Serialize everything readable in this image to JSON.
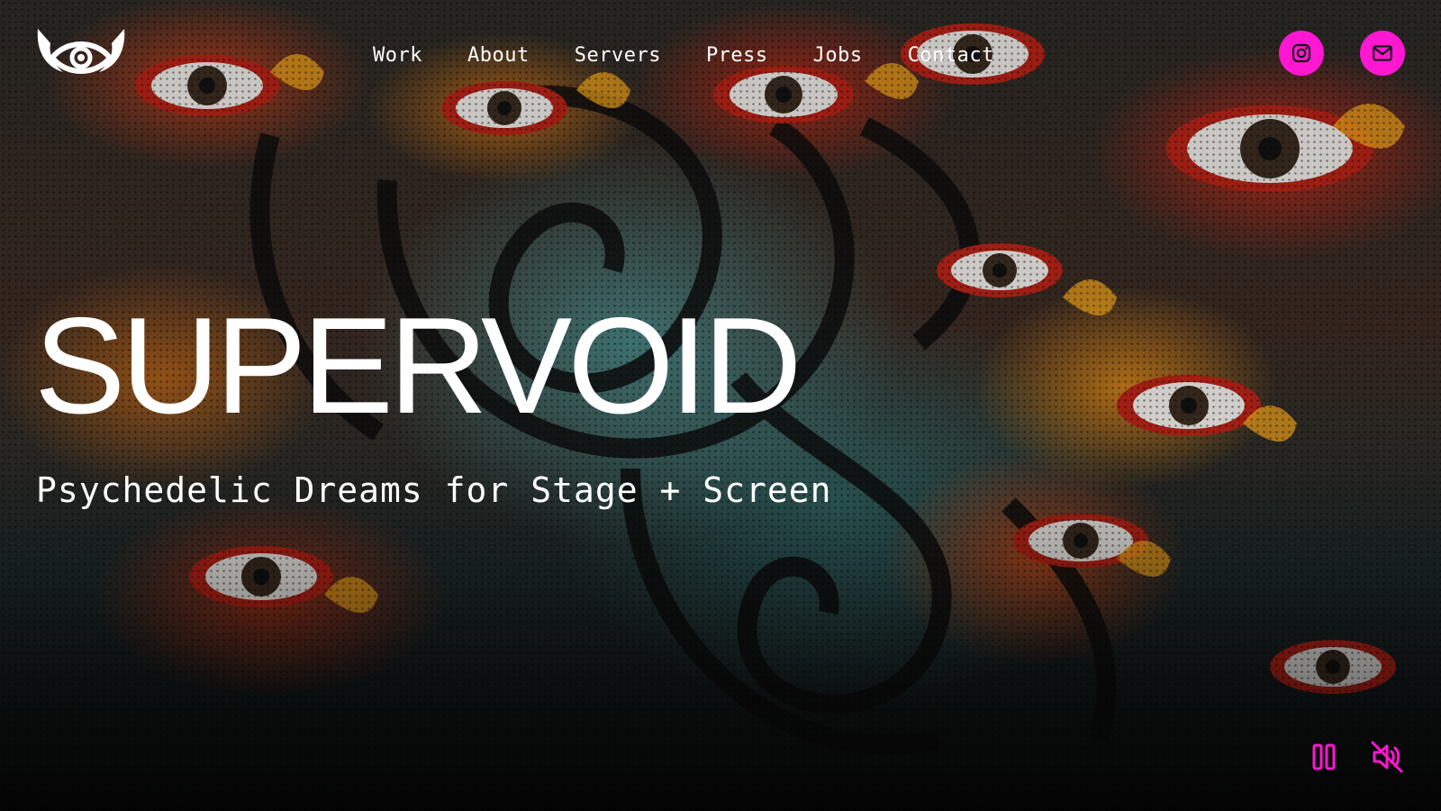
{
  "header": {
    "logo_icon": "eye-horns-logo-icon",
    "nav": [
      {
        "label": "Work"
      },
      {
        "label": "About"
      },
      {
        "label": "Servers"
      },
      {
        "label": "Press"
      },
      {
        "label": "Jobs"
      },
      {
        "label": "Contact"
      }
    ],
    "social": {
      "instagram_icon": "instagram-icon",
      "email_icon": "mail-icon",
      "accent_color": "#ff17d1"
    }
  },
  "hero": {
    "title": "SUPERVOID",
    "tagline": "Psychedelic Dreams for Stage + Screen",
    "background": "psychedelic-eyes-flames-video"
  },
  "video_controls": {
    "pause_icon": "pause-icon",
    "mute_icon": "muted-speaker-icon",
    "color": "#ff17d1"
  }
}
